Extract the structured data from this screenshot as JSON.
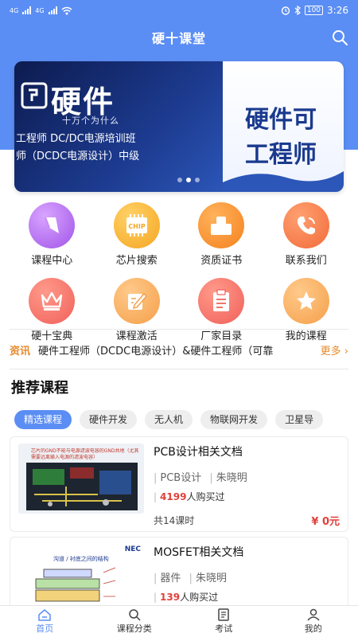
{
  "status_bar": {
    "carrier_left": "4G",
    "carrier_right": "4G",
    "battery": "100",
    "time": "3:26"
  },
  "header": {
    "title": "硬十课堂"
  },
  "banner": {
    "big_text": "硬件",
    "small_text": "十万个为什么",
    "line1": "工程师 DC/DC电源培训班",
    "line2": "师（DCDC电源设计）中级",
    "right_line1": "硬件可",
    "right_line2": "工程师"
  },
  "grid": [
    {
      "label": "课程中心",
      "icon": "course-center-icon",
      "color": "#b86ef0"
    },
    {
      "label": "芯片搜索",
      "icon": "chip-icon",
      "color": "#f5a623",
      "chip_text": "CHIP"
    },
    {
      "label": "资质证书",
      "icon": "certificate-icon",
      "color": "#f5821f"
    },
    {
      "label": "联系我们",
      "icon": "phone-icon",
      "color": "#f26b3a"
    },
    {
      "label": "硬十宝典",
      "icon": "crown-icon",
      "color": "#f0605a"
    },
    {
      "label": "课程激活",
      "icon": "edit-icon",
      "color": "#f5a04a"
    },
    {
      "label": "厂家目录",
      "icon": "catalog-icon",
      "color": "#f0605a"
    },
    {
      "label": "我的课程",
      "icon": "star-icon",
      "color": "#f5a04a"
    }
  ],
  "news": {
    "tag": "资讯",
    "text": "硬件工程师（DCDC电源设计）&硬件工程师（可靠",
    "more": "更多 ›"
  },
  "section": {
    "title": "推荐课程"
  },
  "tabs": [
    "精选课程",
    "硬件开发",
    "无人机",
    "物联网开发",
    "卫星导"
  ],
  "courses": [
    {
      "title": "PCB设计相关文档",
      "category": "PCB设计",
      "teacher": "朱晓明",
      "buyers": "4199",
      "buyers_suffix": "人购买过",
      "lessons": "共14课时",
      "price": "¥ 0元",
      "thumb_caption": "芯片的GND不能与电源滤波电容的GND共地（尤其需要远离输入电源的滤波电容）"
    },
    {
      "title": "MOSFET相关文档",
      "category": "器件",
      "teacher": "朱晓明",
      "buyers": "139",
      "buyers_suffix": "人购买过",
      "thumb_caption": "沟道 / 衬底之间的结构",
      "thumb_brand": "NEC"
    }
  ],
  "bottom_nav": [
    {
      "label": "首页",
      "icon": "home-icon",
      "active": true
    },
    {
      "label": "课程分类",
      "icon": "search-icon",
      "active": false
    },
    {
      "label": "考试",
      "icon": "exam-icon",
      "active": false
    },
    {
      "label": "我的",
      "icon": "user-icon",
      "active": false
    }
  ],
  "colors": {
    "primary": "#5b8ef4",
    "accent_orange": "#e8892b",
    "price_red": "#e0413a"
  }
}
